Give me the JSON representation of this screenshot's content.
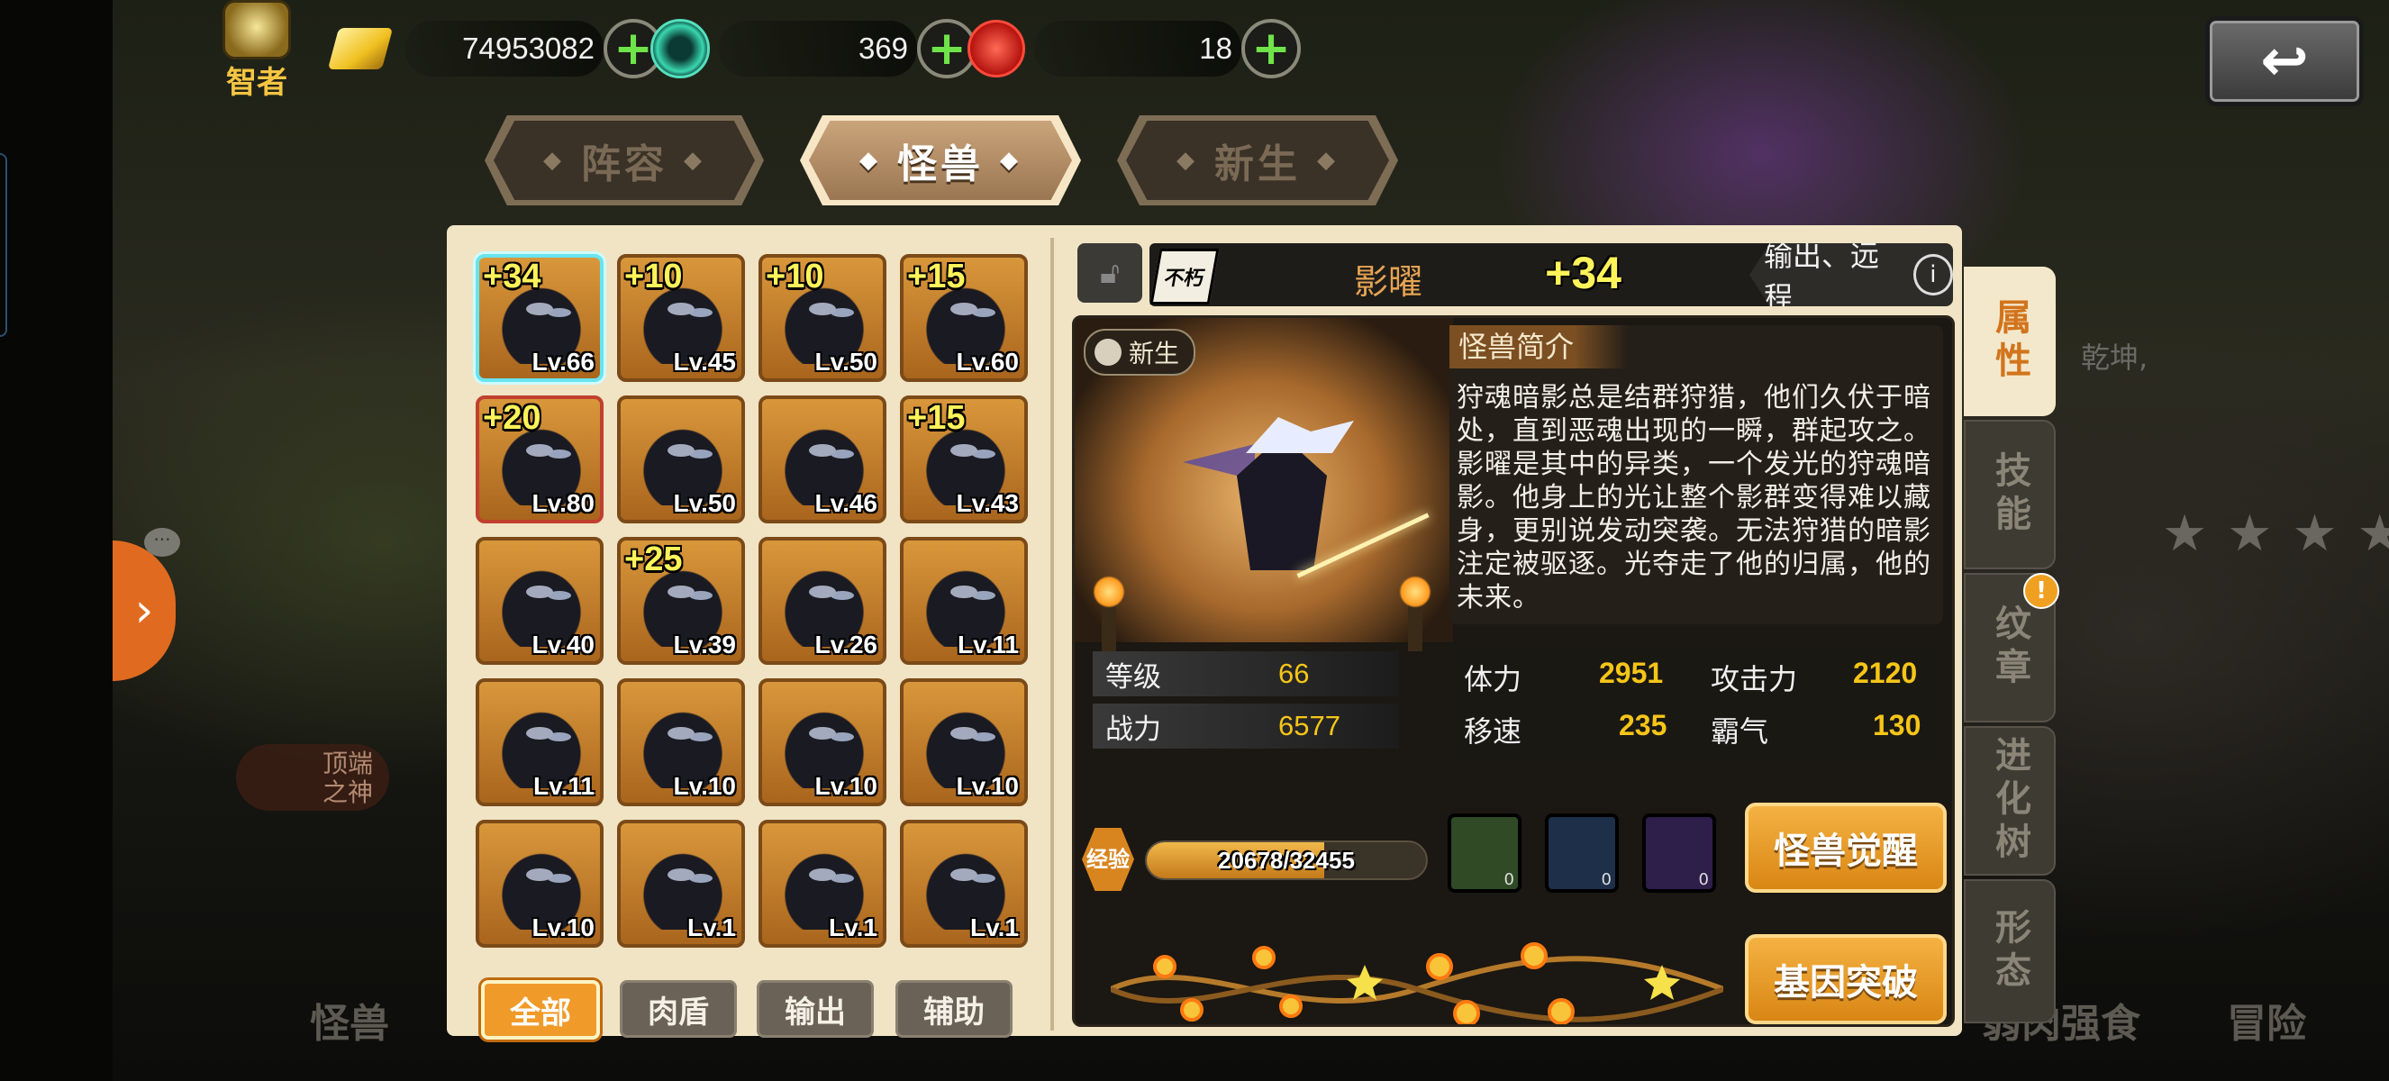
{
  "header": {
    "rank_label": "智者",
    "gold": "74953082",
    "green_gem": "369",
    "red_gem": "18"
  },
  "tabs": [
    {
      "label": "阵容",
      "active": false
    },
    {
      "label": "怪兽",
      "active": true
    },
    {
      "label": "新生",
      "active": false
    }
  ],
  "monsters": [
    {
      "plus": "+34",
      "level": "Lv.66",
      "selected": true
    },
    {
      "plus": "+10",
      "level": "Lv.45"
    },
    {
      "plus": "+10",
      "level": "Lv.50"
    },
    {
      "plus": "+15",
      "level": "Lv.60"
    },
    {
      "plus": "+20",
      "level": "Lv.80",
      "red": true
    },
    {
      "plus": "",
      "level": "Lv.50"
    },
    {
      "plus": "",
      "level": "Lv.46"
    },
    {
      "plus": "+15",
      "level": "Lv.43"
    },
    {
      "plus": "",
      "level": "Lv.40"
    },
    {
      "plus": "+25",
      "level": "Lv.39"
    },
    {
      "plus": "",
      "level": "Lv.26"
    },
    {
      "plus": "",
      "level": "Lv.11"
    },
    {
      "plus": "",
      "level": "Lv.11"
    },
    {
      "plus": "",
      "level": "Lv.10"
    },
    {
      "plus": "",
      "level": "Lv.10"
    },
    {
      "plus": "",
      "level": "Lv.10"
    },
    {
      "plus": "",
      "level": "Lv.10"
    },
    {
      "plus": "",
      "level": "Lv.1"
    },
    {
      "plus": "",
      "level": "Lv.1"
    },
    {
      "plus": "",
      "level": "Lv.1"
    }
  ],
  "filters": [
    {
      "label": "全部",
      "active": true
    },
    {
      "label": "肉盾",
      "active": false
    },
    {
      "label": "输出",
      "active": false
    },
    {
      "label": "辅助",
      "active": false
    }
  ],
  "detail": {
    "rarity": "不朽",
    "name": "影曜",
    "plus": "+34",
    "role": "输出、远程",
    "info_icon": "i",
    "newborn_tag": "新生",
    "intro_title": "怪兽简介",
    "intro_text": "狩魂暗影总是结群狩猎，他们久伏于暗处，直到恶魂出现的一瞬，群起攻之。影曜是其中的异类，一个发光的狩魂暗影。他身上的光让整个影群变得难以藏身，更别说发动突袭。无法狩猎的暗影注定被驱逐。光夺走了他的归属，他的未来。",
    "level_label": "等级",
    "level": "66",
    "power_label": "战力",
    "power": "6577",
    "stats": {
      "hp_label": "体力",
      "hp": "2951",
      "atk_label": "攻击力",
      "atk": "2120",
      "spd_label": "移速",
      "spd": "235",
      "dom_label": "霸气",
      "dom": "130"
    },
    "exp_label": "经验",
    "exp_text": "20678/32455",
    "exp_fraction": 0.637,
    "items": [
      {
        "icon": "cabbage-icon",
        "count": "0",
        "border": "#3f6a2a"
      },
      {
        "icon": "meat-leg-icon",
        "count": "0",
        "border": "#3a5a8a"
      },
      {
        "icon": "steak-icon",
        "count": "0",
        "border": "#6a3aa0"
      }
    ],
    "awaken_button": "怪兽觉醒",
    "gene_button": "基因突破"
  },
  "side_tabs": [
    {
      "label": "属性",
      "active": true
    },
    {
      "label": "技能",
      "active": false
    },
    {
      "label": "纹章",
      "active": false,
      "alert": "!"
    },
    {
      "label": "进化树",
      "active": false
    },
    {
      "label": "形态",
      "active": false
    }
  ],
  "background": {
    "god_tag": "顶端之神",
    "qian_text": "乾坤,",
    "nav_monster": "怪兽",
    "nav_prey": "弱肉强食",
    "nav_adventure": "冒险",
    "stars": "★★★★"
  },
  "colors": {
    "accent_orange": "#f09a2a",
    "stat_yellow": "#f5c518",
    "panel_bg": "#f0e4c4",
    "plus_green": "#6fe34a"
  }
}
